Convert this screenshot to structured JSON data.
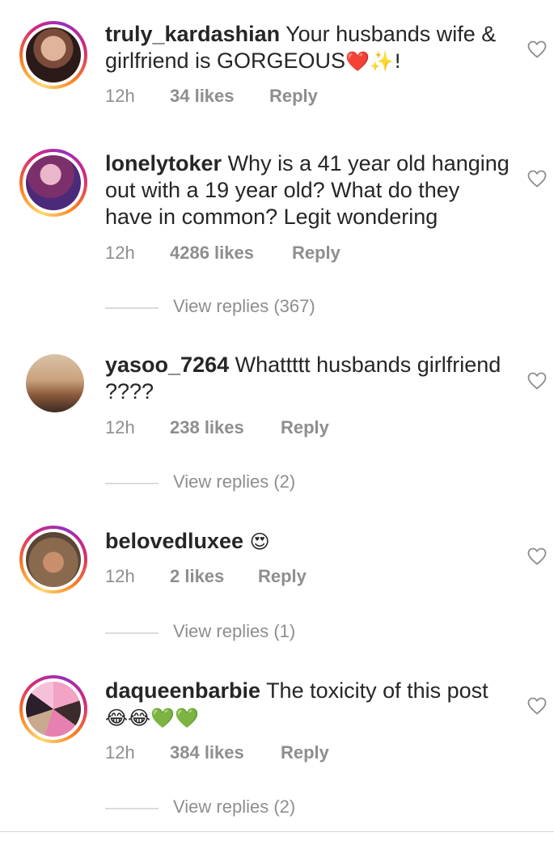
{
  "comments": [
    {
      "username": "truly_kardashian",
      "text": "Your husbands wife & girlfriend is GORGEOUS",
      "emojis": "❤️✨!",
      "time": "12h",
      "likes": "34 likes",
      "reply": "Reply"
    },
    {
      "username": "lonelytoker",
      "text": "Why is a 41 year old hanging out with a 19 year old? What do they have in common? Legit wondering",
      "emojis": "",
      "time": "12h",
      "likes": "4286 likes",
      "reply": "Reply",
      "view_replies": "View replies (367)"
    },
    {
      "username": "yasoo_7264",
      "text": "Whattttt husbands girlfriend ????",
      "emojis": "",
      "time": "12h",
      "likes": "238 likes",
      "reply": "Reply",
      "view_replies": "View replies (2)"
    },
    {
      "username": "belovedluxee",
      "text": "",
      "emojis": "😍",
      "time": "12h",
      "likes": "2 likes",
      "reply": "Reply",
      "view_replies": "View replies (1)"
    },
    {
      "username": "daqueenbarbie",
      "text": "The toxicity of this post",
      "emojis": "😂😂💚💚",
      "time": "12h",
      "likes": "384 likes",
      "reply": "Reply",
      "view_replies": "View replies (2)"
    }
  ],
  "colors": {
    "text": "#262626",
    "muted": "#8e8e8e",
    "divider": "#dbdbdb",
    "story_ring": [
      "#feda75",
      "#fa7e1e",
      "#d62976",
      "#962fbf"
    ]
  },
  "icons": {
    "like": "heart-outline-icon"
  }
}
